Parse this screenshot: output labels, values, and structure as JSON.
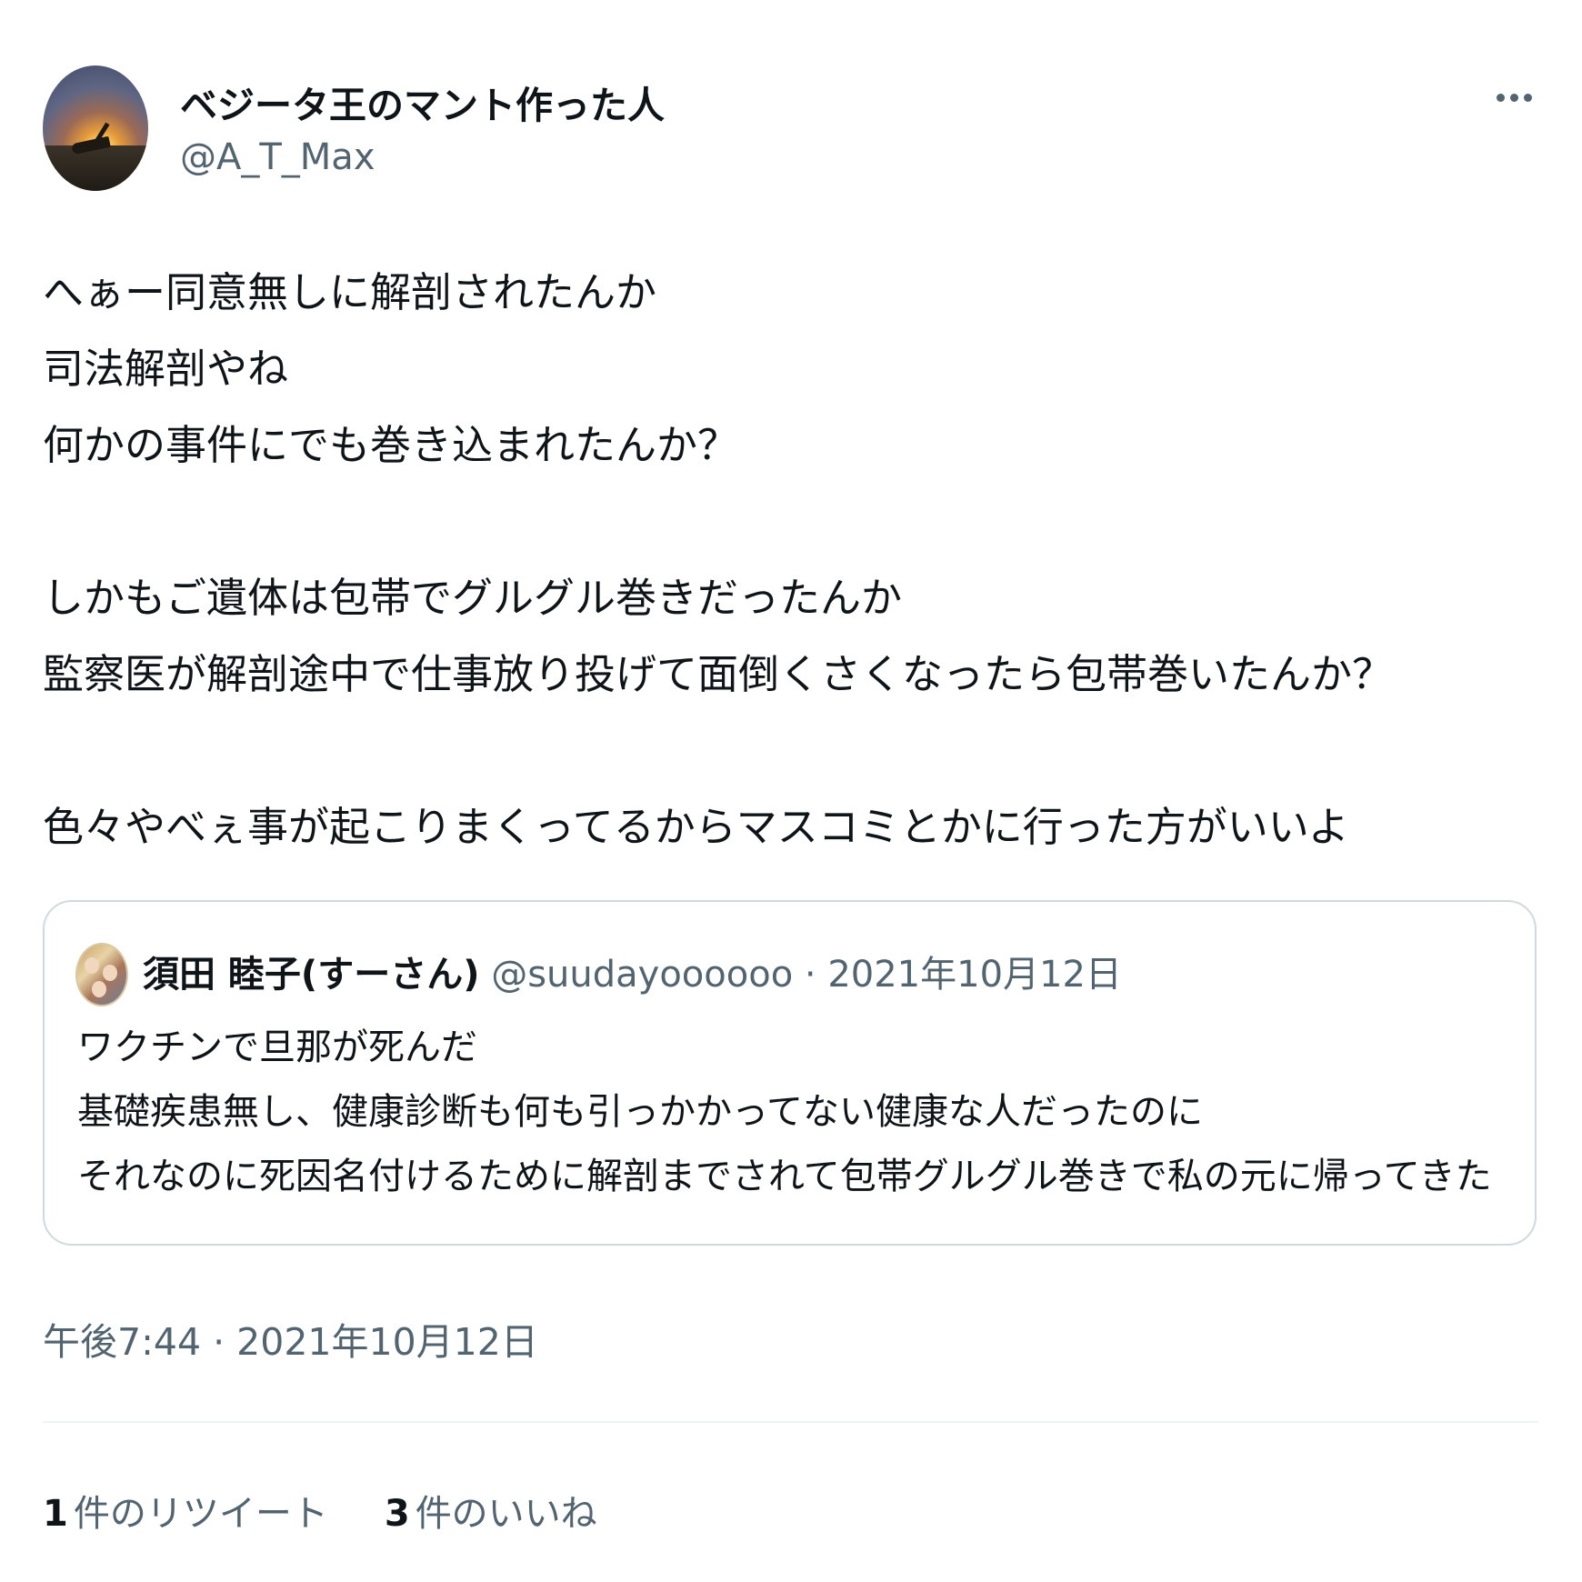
{
  "author": {
    "display_name": "ベジータ王のマント作った人",
    "handle": "@A_T_Max"
  },
  "icons": {
    "more": "more-horizontal-icon",
    "avatar": "user-avatar"
  },
  "tweet": {
    "lines": [
      "へぁー同意無しに解剖されたんか",
      "司法解剖やね",
      "何かの事件にでも巻き込まれたんか？",
      "",
      "しかもご遺体は包帯でグルグル巻きだったんか",
      "監察医が解剖途中で仕事放り投げて面倒くさくなったら包帯巻いたんか？",
      "",
      "色々やべぇ事が起こりまくってるからマスコミとかに行った方がいいよ"
    ]
  },
  "quote": {
    "name": "須田 睦子(すーさん)",
    "handle": "@suudayoooooo",
    "separator": "·",
    "date": "2021年10月12日",
    "lines": [
      "ワクチンで旦那が死んだ",
      "基礎疾患無し、健康診断も何も引っかかってない健康な人だったのに",
      "それなのに死因名付けるために解剖までされて包帯グルグル巻きで私の元に帰ってきた"
    ]
  },
  "timestamp": "午後7:44 · 2021年10月12日",
  "stats": {
    "retweets": {
      "count": "1",
      "label": "件のリツイート"
    },
    "likes": {
      "count": "3",
      "label": "件のいいね"
    }
  },
  "colors": {
    "text": "#0f1419",
    "secondary": "#536471",
    "border": "#cfd9de",
    "divider": "#eff3f4"
  }
}
